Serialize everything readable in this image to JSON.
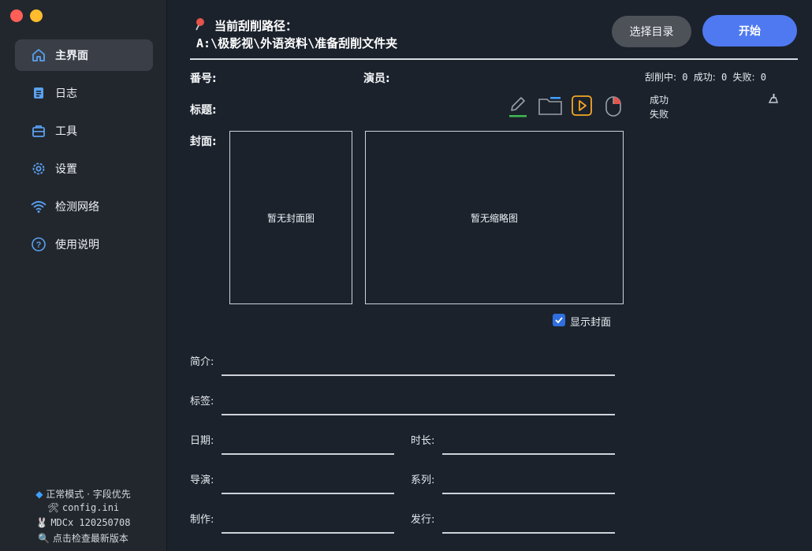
{
  "sidebar": {
    "items": [
      {
        "label": "主界面",
        "icon": "home-icon",
        "active": true
      },
      {
        "label": "日志",
        "icon": "log-icon"
      },
      {
        "label": "工具",
        "icon": "toolbox-icon"
      },
      {
        "label": "设置",
        "icon": "gear-icon"
      },
      {
        "label": "检测网络",
        "icon": "wifi-icon"
      },
      {
        "label": "使用说明",
        "icon": "help-icon"
      }
    ],
    "footer": {
      "mode": "正常模式 · 字段优先",
      "config": "config.ini",
      "version": "MDCx 120250708",
      "update": "点击检查最新版本"
    }
  },
  "header": {
    "path_title": "当前刮削路径：",
    "path_value": "A:\\极影视\\外语资料\\准备刮削文件夹",
    "select_dir_button": "选择目录",
    "start_button": "开始"
  },
  "info": {
    "number_label": "番号:",
    "actor_label": "演员:",
    "title_label": "标题:",
    "cover_label": "封面:",
    "stats": {
      "scraping_label": "刮削中:",
      "scraping_value": "0",
      "success_label": "成功:",
      "success_value": "0",
      "fail_label": "失败:",
      "fail_value": "0"
    },
    "result_list": [
      "成功",
      "失败"
    ],
    "no_cover": "暂无封面图",
    "no_thumb": "暂无缩略图",
    "show_cover": "显示封面"
  },
  "fields": {
    "intro": "简介:",
    "tags": "标签:",
    "date": "日期:",
    "duration": "时长:",
    "director": "导演:",
    "series": "系列:",
    "maker": "制作:",
    "publisher": "发行:"
  },
  "colors": {
    "accent": "#4f79f0",
    "checkbox": "#2f6fdf",
    "play_icon": "#f5a623",
    "edit_underline": "#3fb950"
  }
}
